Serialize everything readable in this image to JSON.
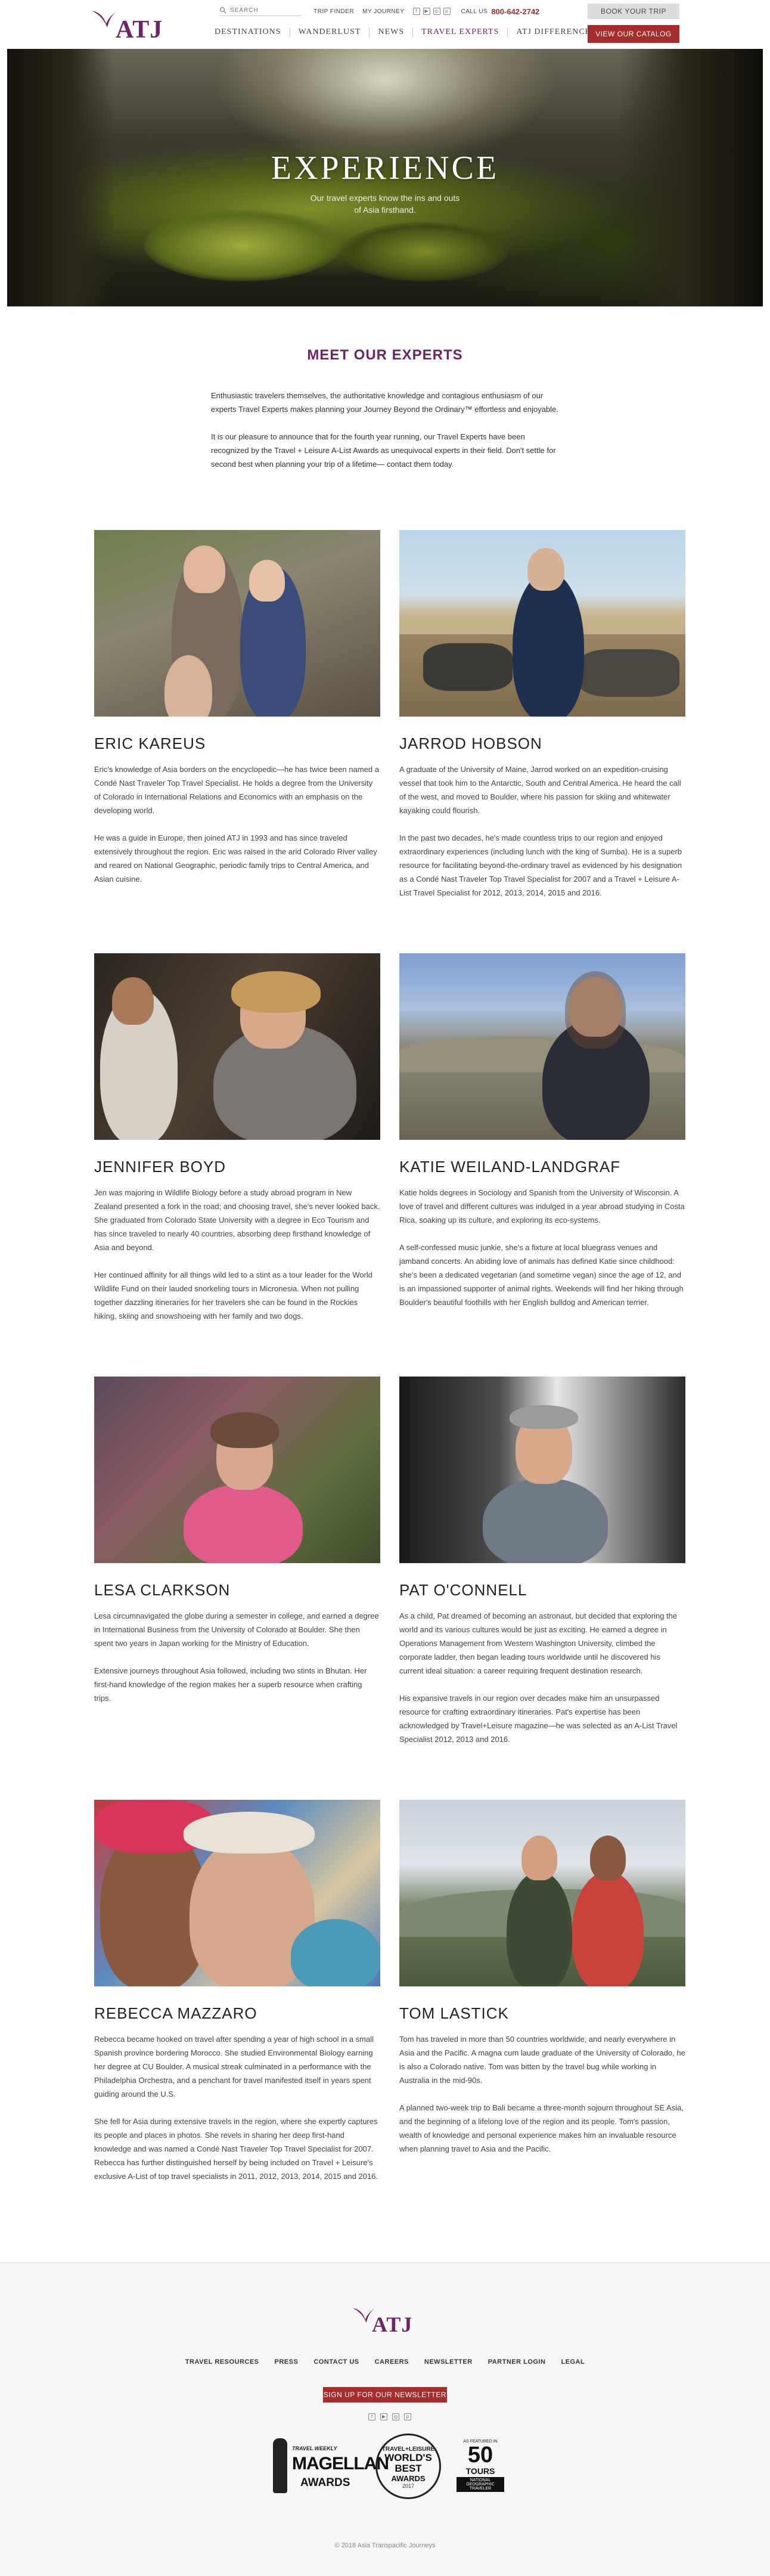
{
  "header": {
    "logo_text": "ATJ",
    "search_placeholder": "SEARCH",
    "util_links": [
      "TRIP FINDER",
      "MY JOURNEY"
    ],
    "call_label": "CALL US",
    "phone": "800-642-2742",
    "book_button": "BOOK YOUR TRIP",
    "catalog_button": "VIEW OUR CATALOG",
    "nav": [
      "DESTINATIONS",
      "WANDERLUST",
      "NEWS",
      "TRAVEL EXPERTS",
      "ATJ DIFFERENCE"
    ]
  },
  "hero": {
    "title": "Experience",
    "subtitle_line1": "Our travel experts know the ins and outs",
    "subtitle_line2": "of Asia firsthand."
  },
  "intro": {
    "heading": "MEET OUR EXPERTS",
    "paragraphs": [
      "Enthusiastic travelers themselves, the authoritative knowledge and contagious enthusiasm of our experts Travel Experts makes planning your Journey Beyond the Ordinary™ effortless and enjoyable.",
      "It is our pleasure to announce that for the fourth year running, our Travel Experts have been recognized by the Travel + Leisure A-List Awards as unequivocal experts in their field. Don't settle for second best when planning your trip of a lifetime— contact them today."
    ]
  },
  "experts": [
    {
      "name": "ERIC KAREUS",
      "bio": [
        "Eric's knowledge of Asia borders on the encyclopedic—he has twice been named a Condé Nast Traveler Top Travel Specialist. He holds a degree from the University of Colorado in International Relations and Economics with an emphasis on the developing world.",
        "He was a guide in Europe, then joined ATJ in 1993 and has since traveled extensively throughout the region. Eric was raised in the arid Colorado River valley and reared on National Geographic, periodic family trips to Central America, and Asian cuisine."
      ]
    },
    {
      "name": "JARROD HOBSON",
      "bio": [
        "A graduate of the University of Maine, Jarrod worked on an expedition-cruising vessel that took him to the Antarctic, South and Central America. He heard the call of the west, and moved to Boulder, where his passion for skiing and whitewater kayaking could flourish.",
        "In the past two decades, he's made countless trips to our region and enjoyed extraordinary experiences (including lunch with the king of Sumba). He is a superb resource for facilitating beyond-the-ordinary travel as evidenced by his designation as a Condé Nast Traveler Top Travel Specialist for 2007 and a Travel + Leisure A-List Travel Specialist for 2012, 2013, 2014, 2015 and 2016."
      ]
    },
    {
      "name": "JENNIFER BOYD",
      "bio": [
        "Jen was majoring in Wildlife Biology before a study abroad program in New Zealand presented a fork in the road; and choosing travel, she's never looked back. She graduated from Colorado State University with a degree in Eco Tourism and has since traveled to nearly 40 countries, absorbing deep firsthand knowledge of Asia and beyond.",
        "Her continued affinity for all things wild led to a stint as a tour leader for the World Wildlife Fund on their lauded snorkeling tours in Micronesia. When not pulling together dazzling itineraries for her travelers she can be found in the Rockies hiking, skiing and snowshoeing with her family and two dogs."
      ]
    },
    {
      "name": "KATIE WEILAND-LANDGRAF",
      "bio": [
        "Katie holds degrees in Sociology and Spanish from the University of Wisconsin. A love of travel and different cultures was indulged in a year abroad studying in Costa Rica, soaking up its culture, and exploring its eco-systems.",
        "A self-confessed music junkie, she's a fixture at local bluegrass venues and jamband concerts. An abiding love of animals has defined Katie since childhood: she's been a dedicated vegetarian (and sometime vegan) since the age of 12, and is an impassioned supporter of animal rights. Weekends will find her hiking through Boulder's beautiful foothills with her English bulldog and American terrier."
      ]
    },
    {
      "name": "LESA CLARKSON",
      "bio": [
        "Lesa circumnavigated the globe during a semester in college, and earned a degree in International Business from the University of Colorado at Boulder. She then spent two years in Japan working for the Ministry of Education.",
        "Extensive journeys throughout Asia followed, including two stints in Bhutan. Her first-hand knowledge of the region makes her a superb resource when crafting trips."
      ]
    },
    {
      "name": "PAT O'CONNELL",
      "bio": [
        "As a child, Pat dreamed of becoming an astronaut, but decided that exploring the world and its various cultures would be just as exciting. He earned a degree in Operations Management from Western Washington University, climbed the corporate ladder, then began leading tours worldwide until he discovered his current ideal situation: a career requiring frequent destination research.",
        "His expansive travels in our region over decades make him an unsurpassed resource for crafting extraordinary itineraries. Pat's expertise has been acknowledged by Travel+Leisure magazine—he was selected as an A-List Travel Specialist 2012, 2013 and 2016."
      ]
    },
    {
      "name": "REBECCA MAZZARO",
      "bio": [
        "Rebecca became hooked on travel after spending a year of high school in a small Spanish province bordering Morocco. She studied Environmental Biology earning her degree at CU Boulder. A musical streak culminated in a performance with the Philadelphia Orchestra, and a penchant for travel manifested itself in years spent guiding around the U.S.",
        "She fell for Asia during extensive travels in the region, where she expertly captures its people and places in photos. She revels in sharing her deep first-hand knowledge and was named a Condé Nast Traveler Top Travel Specialist for 2007. Rebecca has further distinguished herself by being included on Travel + Leisure's exclusive A-List of top travel specialists in 2011, 2012, 2013, 2014, 2015 and 2016."
      ]
    },
    {
      "name": "TOM LASTICK",
      "bio": [
        "Tom has traveled in more than 50 countries worldwide, and nearly everywhere in Asia and the Pacific. A magna cum laude graduate of the University of Colorado, he is also a Colorado native. Tom was bitten by the travel bug while working in Australia in the mid-90s.",
        "A planned two-week trip to Bali became a three-month sojourn throughout SE Asia, and the beginning of a lifelong love of the region and its people. Tom's passion, wealth of knowledge and personal experience makes him an invaluable resource when planning travel to Asia and the Pacific."
      ]
    }
  ],
  "footer": {
    "logo_text": "ATJ",
    "links": [
      "TRAVEL RESOURCES",
      "PRESS",
      "CONTACT US",
      "CAREERS",
      "NEWSLETTER",
      "PARTNER LOGIN",
      "LEGAL"
    ],
    "newsletter_button": "SIGN UP FOR OUR NEWSLETTER",
    "awards": {
      "magellan_small": "TRAVEL WEEKLY",
      "magellan_big": "MAGELLAN",
      "magellan_awards": "AWARDS",
      "wb_top": "TRAVEL+LEISURE",
      "wb_mid": "WORLD'S BEST",
      "wb_awards": "AWARDS",
      "wb_year": "2017",
      "a50_small": "AS FEATURED IN",
      "a50_big": "50",
      "a50_tours": "TOURS",
      "a50_pub": "NATIONAL GEOGRAPHIC TRAVELER"
    },
    "copyright": "© 2018 Asia Transpacific Journeys"
  },
  "colors": {
    "brand_purple": "#6d2467",
    "accent_red": "#a72d2d"
  }
}
